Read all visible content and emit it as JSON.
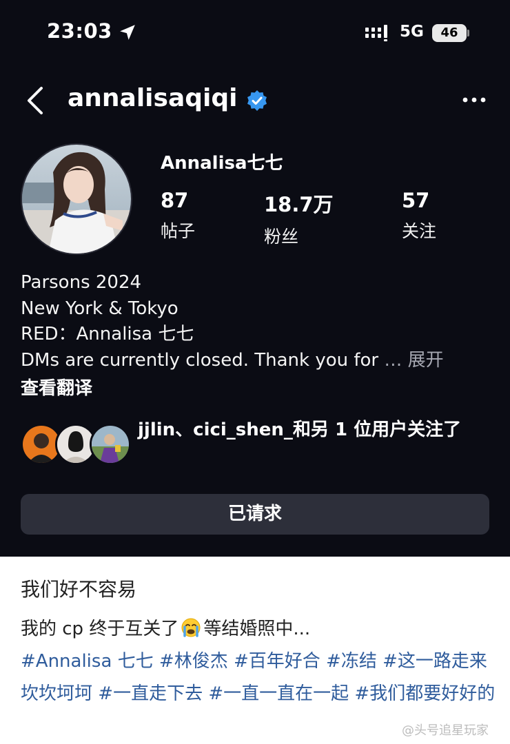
{
  "status_bar": {
    "time": "23:03",
    "network": "5G",
    "battery": "46",
    "icons": [
      "location-arrow-icon",
      "signal-icon",
      "battery-icon"
    ]
  },
  "header": {
    "username": "annalisaqiqi",
    "verified": true,
    "icons": [
      "back-chevron-icon",
      "verified-badge-icon",
      "more-dots-icon"
    ]
  },
  "profile": {
    "display_name": "Annalisa七七",
    "stats": [
      {
        "value": "87",
        "label": "帖子"
      },
      {
        "value": "18.7万",
        "label": "粉丝"
      },
      {
        "value": "57",
        "label": "关注"
      }
    ]
  },
  "bio": {
    "lines": [
      "Parsons 2024",
      "New York & Tokyo",
      "RED：Annalisa 七七",
      "DMs are currently closed. Thank you for"
    ],
    "ellipsis": "…",
    "expand": "展开",
    "translate": "查看翻译"
  },
  "followed_by": {
    "text": "jjlin、cici_shen_和另 1 位用户关注了"
  },
  "request_button": "已请求",
  "post": {
    "title": "我们好不容易",
    "text_prefix": "我的 cp 终于互关了",
    "emoji": "crying-face-icon",
    "text_suffix": "等结婚照中...",
    "hashtags": [
      "#Annalisa 七七",
      "#林俊杰",
      "#百年好合",
      "#冻结",
      "#这一路走来坎坎坷坷",
      "#一直走下去",
      "#一直一直在一起",
      "#我们都要好好的"
    ],
    "watermark": "@头号追星玩家"
  },
  "colors": {
    "dark_bg": "#0b0c14",
    "button_bg": "#2d2f3a",
    "verified_blue": "#3797f0",
    "hashtag_blue": "#2f5c9c"
  }
}
